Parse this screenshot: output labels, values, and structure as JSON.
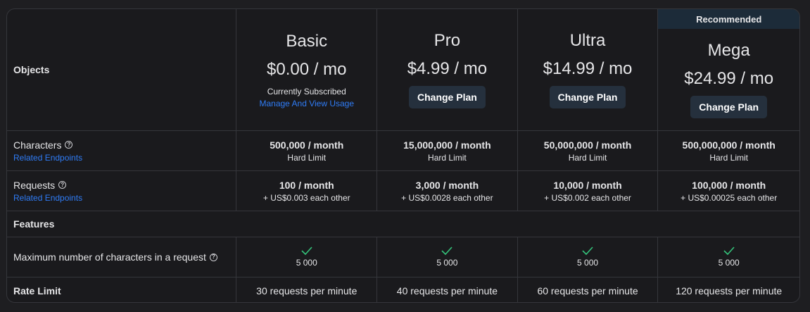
{
  "header": {
    "objects_label": "Objects",
    "recommended_label": "Recommended"
  },
  "plans": [
    {
      "name": "Basic",
      "price": "$0.00 / mo",
      "status": "Currently Subscribed",
      "link": "Manage And View Usage"
    },
    {
      "name": "Pro",
      "price": "$4.99 / mo",
      "button": "Change Plan"
    },
    {
      "name": "Ultra",
      "price": "$14.99 / mo",
      "button": "Change Plan"
    },
    {
      "name": "Mega",
      "price": "$24.99 / mo",
      "button": "Change Plan"
    }
  ],
  "rows": {
    "characters": {
      "label": "Characters",
      "link": "Related Endpoints",
      "values": [
        {
          "main": "500,000 / month",
          "sub": "Hard Limit"
        },
        {
          "main": "15,000,000 / month",
          "sub": "Hard Limit"
        },
        {
          "main": "50,000,000 / month",
          "sub": "Hard Limit"
        },
        {
          "main": "500,000,000 / month",
          "sub": "Hard Limit"
        }
      ]
    },
    "requests": {
      "label": "Requests",
      "link": "Related Endpoints",
      "values": [
        {
          "main": "100 / month",
          "sub": "+ US$0.003 each other"
        },
        {
          "main": "3,000 / month",
          "sub": "+ US$0.0028 each other"
        },
        {
          "main": "10,000 / month",
          "sub": "+ US$0.002 each other"
        },
        {
          "main": "100,000 / month",
          "sub": "+ US$0.00025 each other"
        }
      ]
    },
    "features": {
      "label": "Features"
    },
    "max_chars": {
      "label": "Maximum number of characters in a request",
      "values": [
        "5 000",
        "5 000",
        "5 000",
        "5 000"
      ]
    },
    "rate_limit": {
      "label": "Rate Limit",
      "values": [
        "30 requests per minute",
        "40 requests per minute",
        "60 requests per minute",
        "120 requests per minute"
      ]
    }
  },
  "icons": {
    "help": "?",
    "check": "check-icon"
  },
  "colors": {
    "link": "#2f7cf6",
    "check": "#34c27a",
    "button_bg": "#25303d",
    "recommended_bg": "#1c2b39"
  }
}
